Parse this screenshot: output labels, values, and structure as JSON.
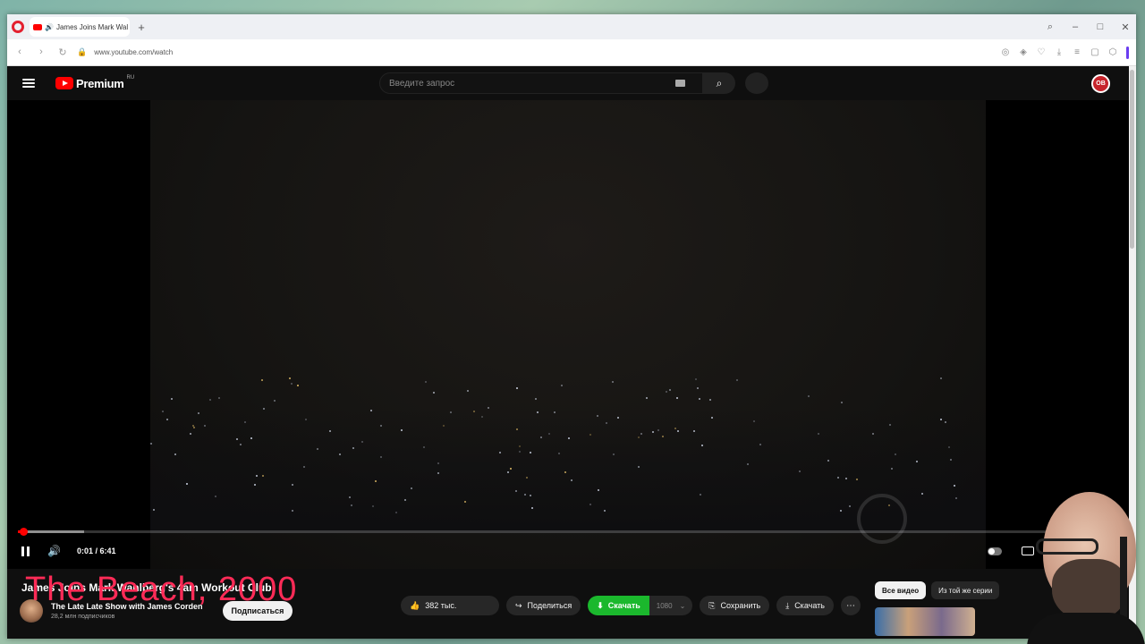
{
  "browser": {
    "tab_title": "James Joins Mark Wal",
    "url": "www.youtube.com/watch"
  },
  "youtube": {
    "logo_text": "Premium",
    "logo_region": "RU",
    "search_placeholder": "Введите запрос",
    "account_initials": "OB"
  },
  "player": {
    "time": "0:01 / 6:41",
    "progress_fraction": 0.001,
    "buffered_fraction": 0.06
  },
  "video": {
    "title": "James Joins Mark Wahlberg's 4am Workout Club",
    "overlay_text": "The Beach, 2000",
    "channel_name": "The Late Late Show with James Corden",
    "channel_subs": "28,2 млн подписчиков",
    "subscribe_label": "Подписаться",
    "likes": "382 тыс.",
    "share_label": "Поделиться",
    "download_green_label": "Скачать",
    "download_quality": "1080",
    "save_label": "Сохранить",
    "download_label": "Скачать"
  },
  "sidebar": {
    "chips": [
      "Все видео",
      "Из той же серии"
    ]
  },
  "colors": {
    "accent": "#ff0000",
    "overlay_text": "#ff2b57",
    "download_green": "#1bb82d"
  }
}
